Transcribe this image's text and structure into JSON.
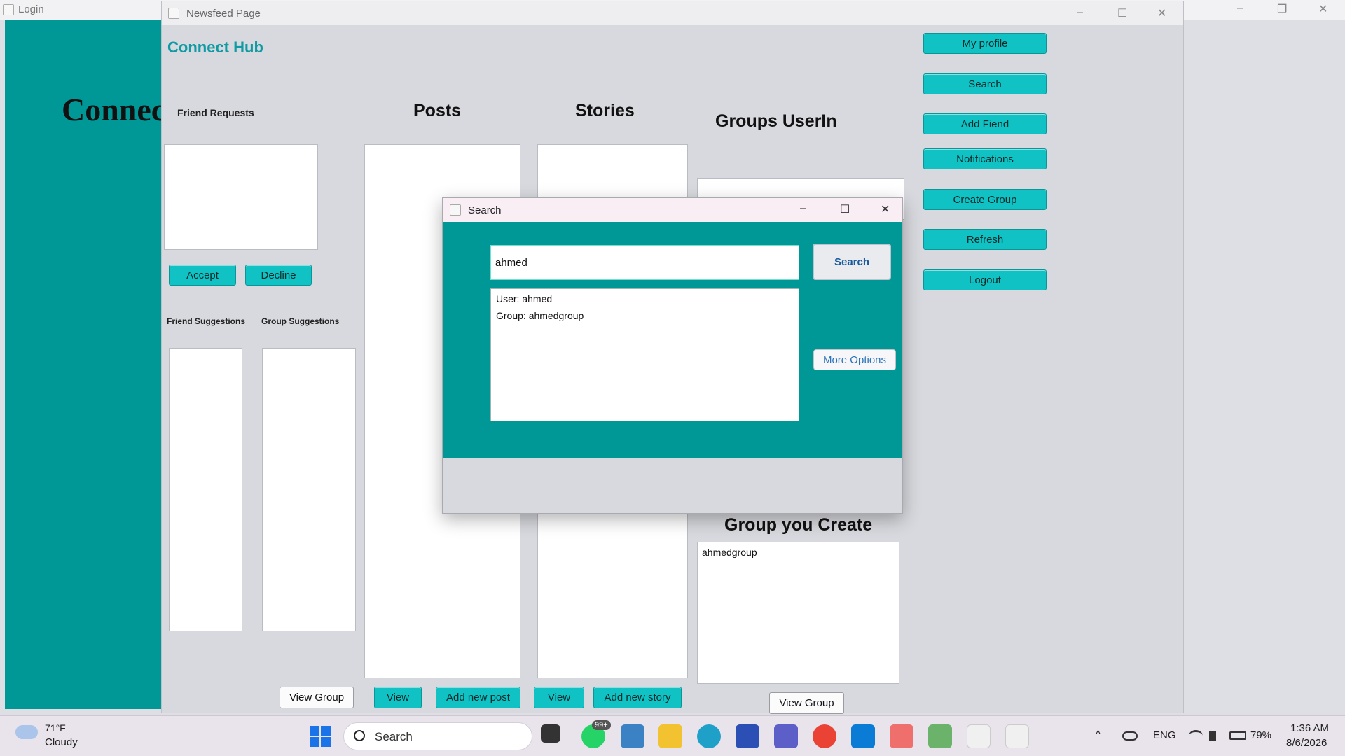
{
  "login_window": {
    "title": "Login",
    "big_text": "Connec"
  },
  "newsfeed": {
    "window_title": "Newsfeed Page",
    "brand": "Connect Hub",
    "friend_requests_label": "Friend Requests",
    "accept_label": "Accept",
    "decline_label": "Decline",
    "friend_suggestions_label": "Friend Suggestions",
    "group_suggestions_label": "Group Suggestions",
    "posts_heading": "Posts",
    "stories_heading": "Stories",
    "groups_userin_heading": "Groups UserIn",
    "group_you_create_heading": "Group you Create",
    "created_groups": [
      "ahmedgroup"
    ],
    "bottom_buttons": {
      "view_group_left": "View Group",
      "view_posts": "View",
      "add_new_post": "Add new post",
      "view_stories": "View",
      "add_new_story": "Add new story",
      "view_group_right": "View Group"
    },
    "side_buttons": [
      "My profile",
      "Search",
      "Add Fiend",
      "Notifications",
      "Create Group",
      "Refresh",
      "Logout"
    ]
  },
  "search_dialog": {
    "title": "Search",
    "query_value": "ahmed",
    "search_button": "Search",
    "results": [
      "User: ahmed",
      "Group: ahmedgroup"
    ],
    "more_options_button": "More Options"
  },
  "window_controls": {
    "minimize": "–",
    "maximize": "☐",
    "close": "✕",
    "restore": "❐"
  },
  "taskbar": {
    "weather_temp": "71°F",
    "weather_desc": "Cloudy",
    "search_placeholder": "Search",
    "whatsapp_badge": "99+",
    "language": "ENG",
    "battery": "79%",
    "time": "1:36 AM",
    "date": "8/6/2026",
    "tray_chevron": "^"
  },
  "colors": {
    "teal": "#009797",
    "button_teal": "#11c2c4",
    "brand": "#109aa4"
  }
}
